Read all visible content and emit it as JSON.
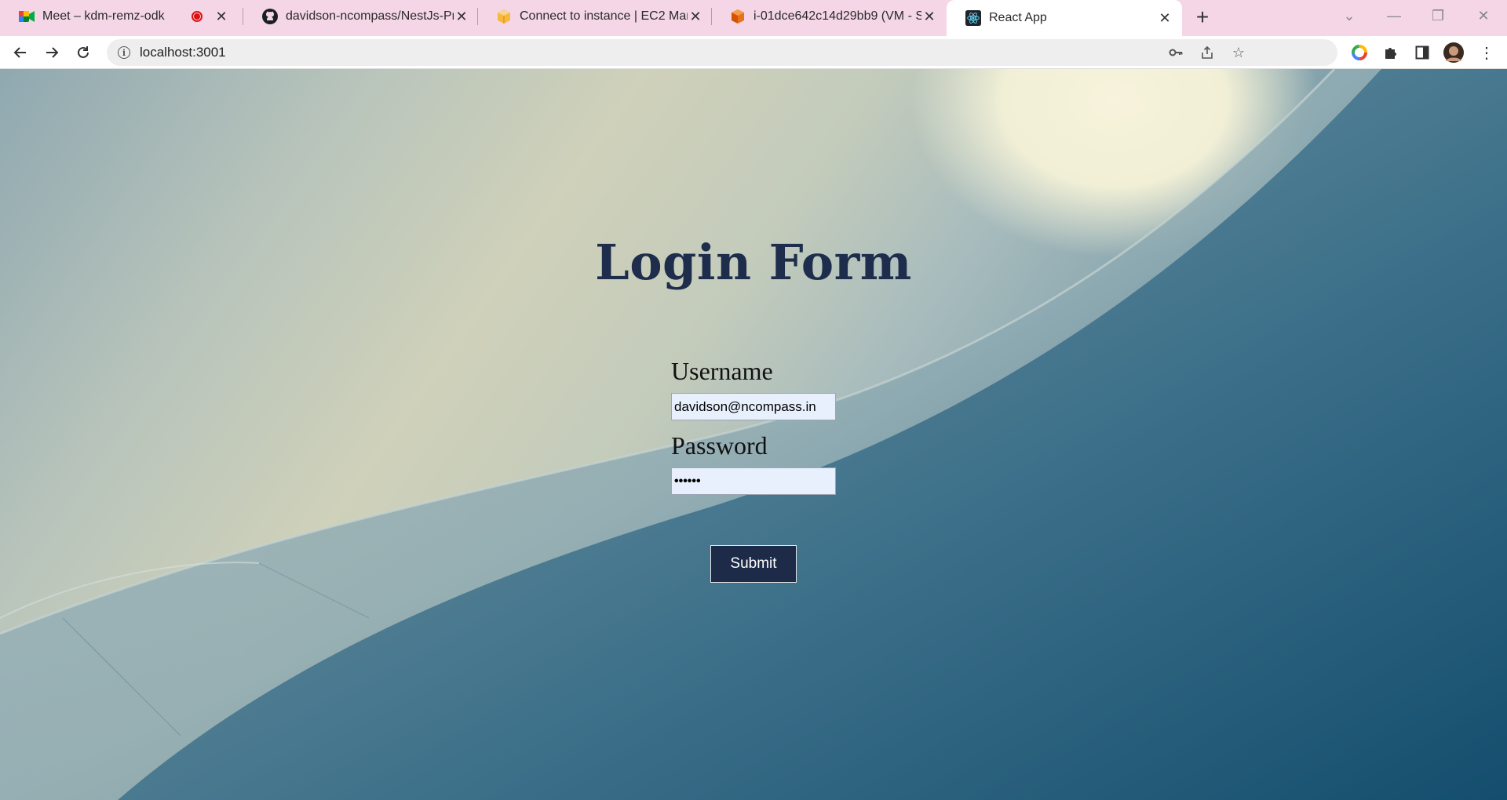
{
  "browser": {
    "tabs": [
      {
        "title": "Meet – kdm-remz-odk",
        "favicon": "google-meet-icon",
        "recording": true
      },
      {
        "title": "davidson-ncompass/NestJs-Proje",
        "favicon": "github-icon"
      },
      {
        "title": "Connect to instance | EC2 Manag",
        "favicon": "aws-box-icon"
      },
      {
        "title": "i-01dce642c14d29bb9 (VM - Swi",
        "favicon": "aws-cube-icon"
      },
      {
        "title": "React App",
        "favicon": "react-icon",
        "active": true
      }
    ],
    "address_bar": {
      "url": "localhost:3001"
    }
  },
  "page": {
    "title": "Login Form",
    "username_label": "Username",
    "username_value": "davidson@ncompass.in",
    "password_label": "Password",
    "password_value": "••••••",
    "submit_label": "Submit"
  },
  "colors": {
    "tab_strip": "#f4d6e6",
    "title_color": "#1e2d4c",
    "button_bg": "#1d2a48",
    "input_bg": "#e8f0fe"
  }
}
